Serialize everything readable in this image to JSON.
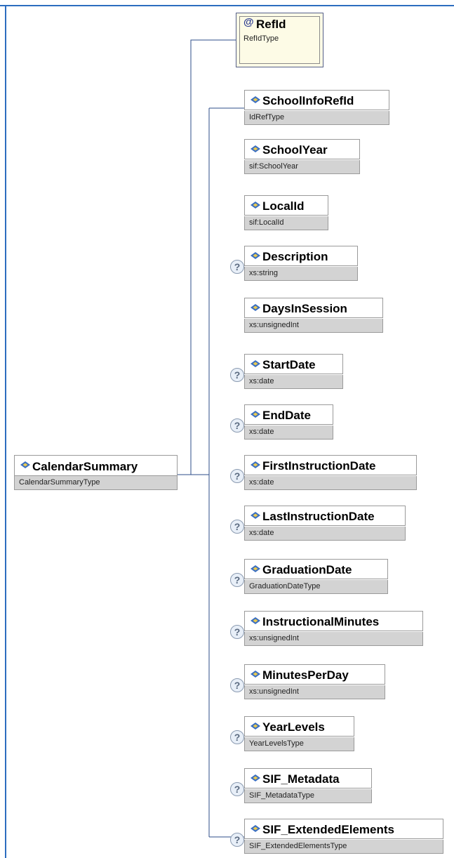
{
  "root": {
    "name": "CalendarSummary",
    "type": "CalendarSummaryType"
  },
  "attribute": {
    "symbol": "@",
    "name": "RefId",
    "type": "RefIdType"
  },
  "optional_symbol": "?",
  "elements": [
    {
      "name": "SchoolInfoRefId",
      "type": "IdRefType",
      "optional": false
    },
    {
      "name": "SchoolYear",
      "type": "sif:SchoolYear",
      "optional": false
    },
    {
      "name": "LocalId",
      "type": "sif:LocalId",
      "optional": false
    },
    {
      "name": "Description",
      "type": "xs:string",
      "optional": true
    },
    {
      "name": "DaysInSession",
      "type": "xs:unsignedInt",
      "optional": false
    },
    {
      "name": "StartDate",
      "type": "xs:date",
      "optional": true
    },
    {
      "name": "EndDate",
      "type": "xs:date",
      "optional": true
    },
    {
      "name": "FirstInstructionDate",
      "type": "xs:date",
      "optional": true
    },
    {
      "name": "LastInstructionDate",
      "type": "xs:date",
      "optional": true
    },
    {
      "name": "GraduationDate",
      "type": "GraduationDateType",
      "optional": true
    },
    {
      "name": "InstructionalMinutes",
      "type": "xs:unsignedInt",
      "optional": true
    },
    {
      "name": "MinutesPerDay",
      "type": "xs:unsignedInt",
      "optional": true
    },
    {
      "name": "YearLevels",
      "type": "YearLevelsType",
      "optional": true
    },
    {
      "name": "SIF_Metadata",
      "type": "SIF_MetadataType",
      "optional": true
    },
    {
      "name": "SIF_ExtendedElements",
      "type": "SIF_ExtendedElementsType",
      "optional": true
    }
  ],
  "colors": {
    "frame": "#2c6dbf",
    "connector": "#2d4e8a",
    "type_bg": "#d3d3d3",
    "attr_bg": "#fdfbe6"
  }
}
